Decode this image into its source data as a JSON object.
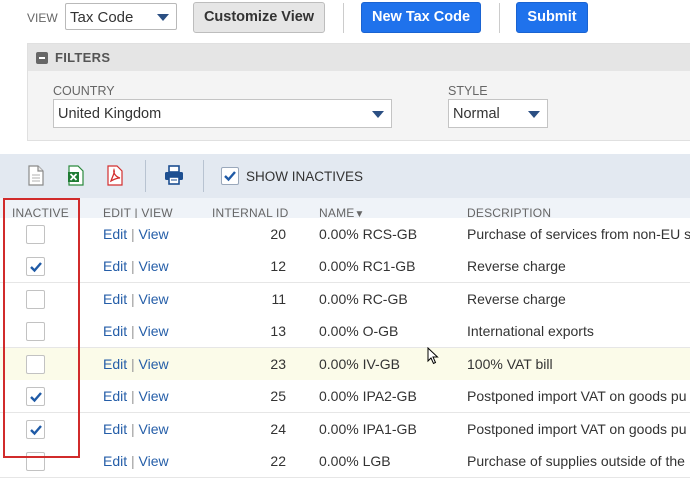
{
  "topbar": {
    "view_label": "VIEW",
    "view_value": "Tax Code",
    "customize_label": "Customize View",
    "new_label": "New Tax Code",
    "submit_label": "Submit"
  },
  "filters": {
    "title": "FILTERS",
    "country_label": "COUNTRY",
    "country_value": "United Kingdom",
    "style_label": "STYLE",
    "style_value": "Normal"
  },
  "toolbar": {
    "icons": [
      "new-document-icon",
      "export-excel-icon",
      "export-pdf-icon",
      "print-icon"
    ],
    "show_inactives_label": "SHOW INACTIVES",
    "show_inactives_checked": true
  },
  "table": {
    "headers": {
      "inactive": "INACTIVE",
      "edit": "EDIT",
      "sep": "|",
      "view": "VIEW",
      "internal_id": "INTERNAL ID",
      "name": "NAME",
      "sort_glyph": "▼",
      "description": "DESCRIPTION"
    },
    "edit_label": "Edit",
    "view_label": "View",
    "rows": [
      {
        "inactive": false,
        "id": "20",
        "name": "0.00% RCS-GB",
        "description": "Purchase of services from non-EU s"
      },
      {
        "inactive": true,
        "id": "12",
        "name": "0.00% RC1-GB",
        "description": "Reverse charge"
      },
      {
        "inactive": false,
        "id": "11",
        "name": "0.00% RC-GB",
        "description": "Reverse charge"
      },
      {
        "inactive": false,
        "id": "13",
        "name": "0.00% O-GB",
        "description": "International exports"
      },
      {
        "inactive": false,
        "id": "23",
        "name": "0.00% IV-GB",
        "description": "100% VAT bill"
      },
      {
        "inactive": true,
        "id": "25",
        "name": "0.00% IPA2-GB",
        "description": "Postponed import VAT on goods pu"
      },
      {
        "inactive": true,
        "id": "24",
        "name": "0.00% IPA1-GB",
        "description": "Postponed import VAT on goods pu"
      },
      {
        "inactive": false,
        "id": "22",
        "name": "0.00% LGB",
        "description": "Purchase of supplies outside of the"
      }
    ]
  },
  "colors": {
    "primary_button": "#1f72ec",
    "link": "#255ea8",
    "highlight_row": "#fbfbe9",
    "annotation_box": "#d12b2b"
  }
}
